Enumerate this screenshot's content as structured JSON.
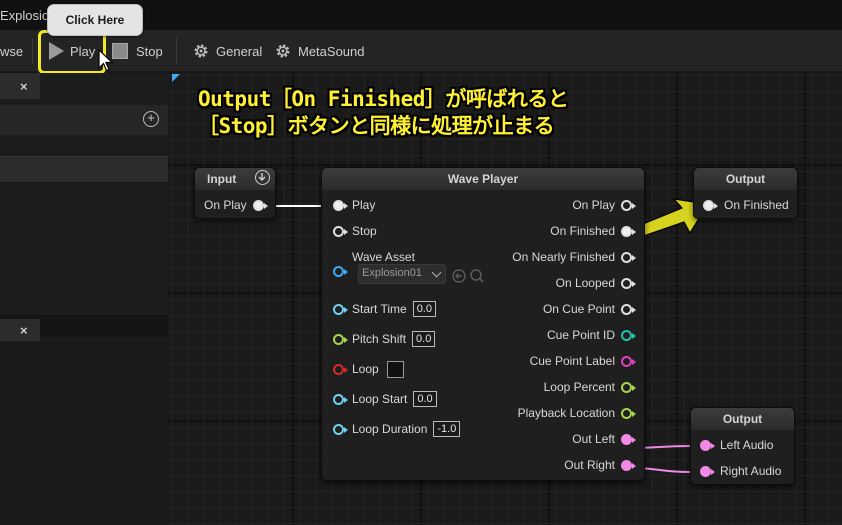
{
  "title_tab": "Explosio",
  "tooltip": "Click Here",
  "toolbar": {
    "browse_label": "wse",
    "play_label": "Play",
    "stop_label": "Stop",
    "general_label": "General",
    "metasound_label": "MetaSound"
  },
  "left_panel": {
    "close_1": "×",
    "close_2": "×",
    "add": "+"
  },
  "annotation": {
    "line1": "Output［On Finished］が呼ばれると",
    "line2": "［Stop］ボタンと同様に処理が止まる"
  },
  "input_node": {
    "title": "Input",
    "pin_on_play": "On Play"
  },
  "wave_player": {
    "title": "Wave Player",
    "inputs": {
      "play": "Play",
      "stop": "Stop",
      "wave_asset": "Wave Asset",
      "asset_value": "Explosion01",
      "start_time": "Start Time",
      "start_time_value": "0.0",
      "pitch_shift": "Pitch Shift",
      "pitch_shift_value": "0.0",
      "loop": "Loop",
      "loop_start": "Loop Start",
      "loop_start_value": "0.0",
      "loop_duration": "Loop Duration",
      "loop_duration_value": "-1.0"
    },
    "outputs": {
      "on_play": "On Play",
      "on_finished": "On Finished",
      "on_nearly_finished": "On Nearly Finished",
      "on_looped": "On Looped",
      "on_cue_point": "On Cue Point",
      "cue_point_id": "Cue Point ID",
      "cue_point_label": "Cue Point Label",
      "loop_percent": "Loop Percent",
      "playback_location": "Playback Location",
      "out_left": "Out Left",
      "out_right": "Out Right"
    }
  },
  "output_finished_node": {
    "title": "Output",
    "pin": "On Finished"
  },
  "output_audio_node": {
    "title": "Output",
    "left": "Left Audio",
    "right": "Right Audio"
  },
  "colors": {
    "highlight": "#f4ea1f",
    "annotation_text": "#fff033",
    "pin_float": "#6fd0f0",
    "pin_bool": "#a8d64a",
    "pin_loop": "#d42a2a",
    "pin_string": "#e040c0",
    "pin_audio": "#f08ae6",
    "pin_int": "#1fc2a6",
    "callout_arrow": "#d6d21e"
  }
}
